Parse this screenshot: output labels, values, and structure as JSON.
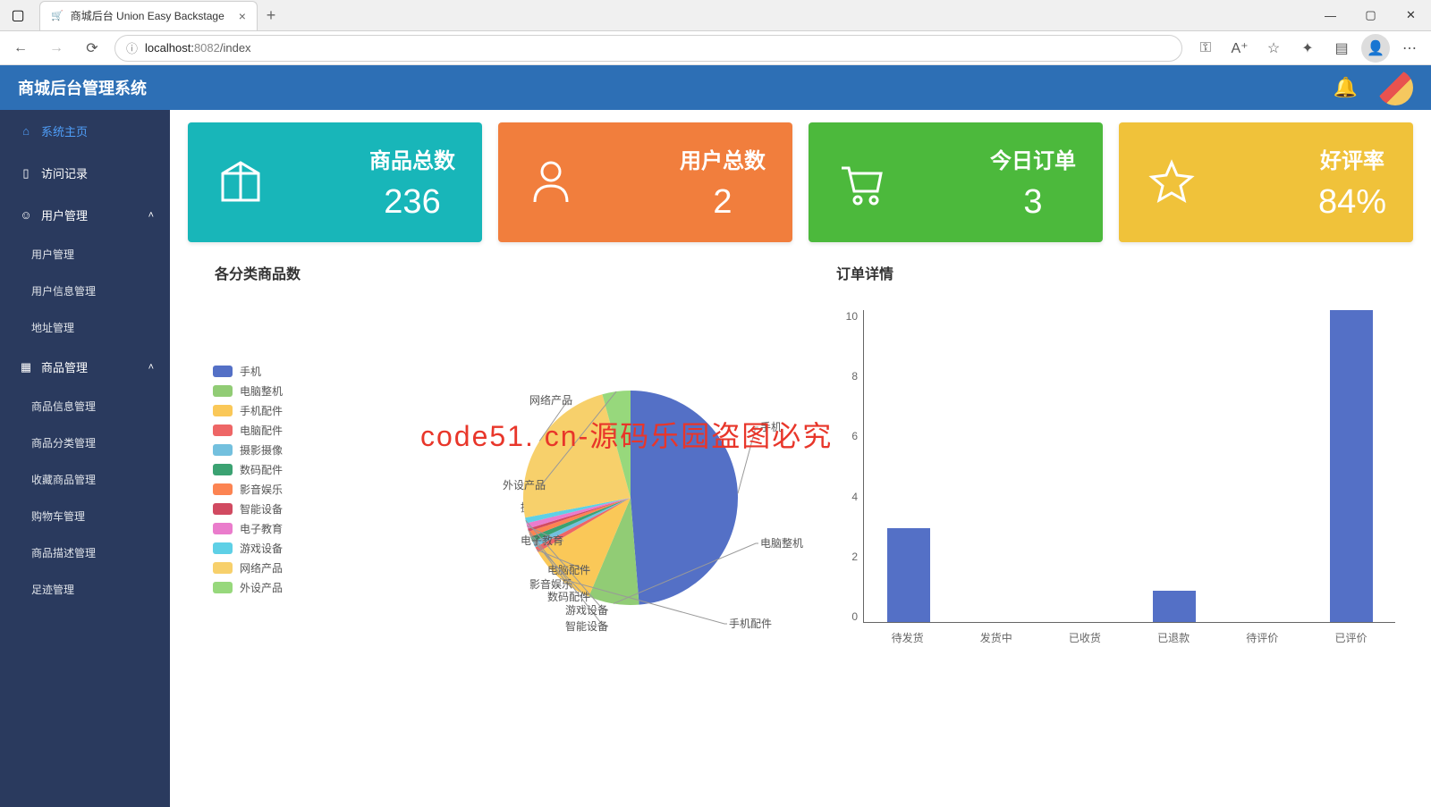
{
  "browser": {
    "tab_title": "商城后台 Union Easy Backstage",
    "url_host": "localhost:",
    "url_port": "8082",
    "url_path": "/index"
  },
  "header": {
    "title": "商城后台管理系统"
  },
  "sidebar": {
    "items": [
      {
        "label": "系统主页",
        "active": true
      },
      {
        "label": "访问记录"
      },
      {
        "label": "用户管理",
        "expand": true,
        "children": [
          "用户管理",
          "用户信息管理",
          "地址管理"
        ]
      },
      {
        "label": "商品管理",
        "expand": true,
        "children": [
          "商品信息管理",
          "商品分类管理",
          "收藏商品管理",
          "购物车管理",
          "商品描述管理",
          "足迹管理"
        ]
      }
    ]
  },
  "stats": [
    {
      "label": "商品总数",
      "value": "236"
    },
    {
      "label": "用户总数",
      "value": "2"
    },
    {
      "label": "今日订单",
      "value": "3"
    },
    {
      "label": "好评率",
      "value": "84%"
    }
  ],
  "chart_titles": {
    "pie": "各分类商品数",
    "bar": "订单详情"
  },
  "watermark": "code51. cn-源码乐园盗图必究",
  "chart_data": [
    {
      "type": "pie",
      "title": "各分类商品数",
      "series": [
        {
          "name": "手机",
          "value": 115,
          "color": "#5470c6"
        },
        {
          "name": "电脑整机",
          "value": 18,
          "color": "#91cc75"
        },
        {
          "name": "手机配件",
          "value": 24,
          "color": "#fac858"
        },
        {
          "name": "电脑配件",
          "value": 2,
          "color": "#ee6666"
        },
        {
          "name": "摄影摄像",
          "value": 2,
          "color": "#73c0de"
        },
        {
          "name": "数码配件",
          "value": 2,
          "color": "#3ba272"
        },
        {
          "name": "影音娱乐",
          "value": 2,
          "color": "#fc8452"
        },
        {
          "name": "智能设备",
          "value": 1,
          "color": "#d14a61"
        },
        {
          "name": "电子教育",
          "value": 2,
          "color": "#ea7ccc"
        },
        {
          "name": "游戏设备",
          "value": 2,
          "color": "#5ed0e6"
        },
        {
          "name": "网络产品",
          "value": 56,
          "color": "#f7d06b"
        },
        {
          "name": "外设产品",
          "value": 10,
          "color": "#97d87c"
        }
      ]
    },
    {
      "type": "bar",
      "title": "订单详情",
      "ylim": [
        0,
        10
      ],
      "yticks": [
        10,
        8,
        6,
        4,
        2,
        0
      ],
      "categories": [
        "待发货",
        "发货中",
        "已收货",
        "已退款",
        "待评价",
        "已评价"
      ],
      "values": [
        3,
        0,
        0,
        1,
        0,
        10
      ]
    }
  ]
}
